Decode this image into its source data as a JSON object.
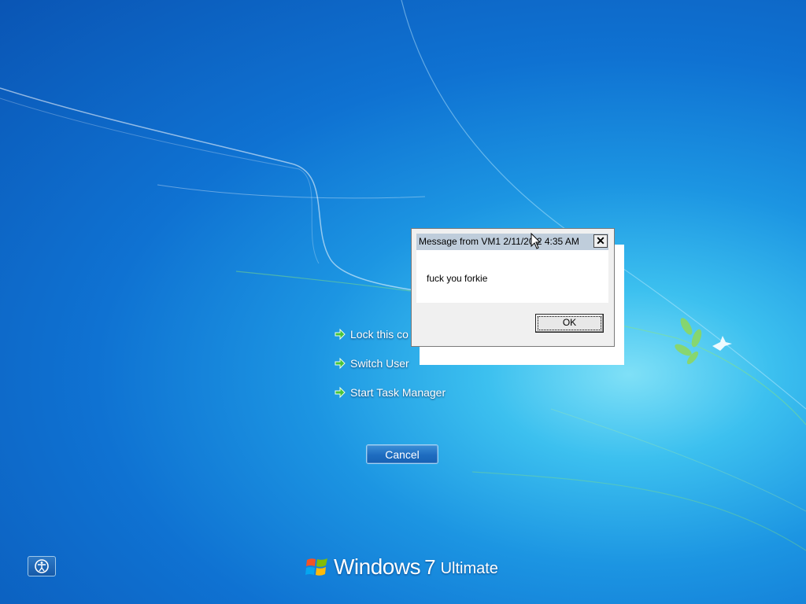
{
  "menu": {
    "items": [
      {
        "label": "Lock this co"
      },
      {
        "label": "Switch User"
      },
      {
        "label": "Start Task Manager"
      }
    ],
    "arrow_icon": "green-arrow-icon",
    "cancel_label": "Cancel"
  },
  "dialog": {
    "title": "Message from VM1 2/11/20  2 4:35 AM",
    "message": "fuck you forkie",
    "ok_label": "OK",
    "close_glyph": "✕"
  },
  "branding": {
    "windows": "Windows",
    "version": "7",
    "edition": "Ultimate"
  },
  "ease_of_access_icon": "ease-of-access-icon",
  "colors": {
    "arrow": "#49c43a",
    "background_dark": "#0a55b4",
    "background_light": "#7fe0f7"
  }
}
